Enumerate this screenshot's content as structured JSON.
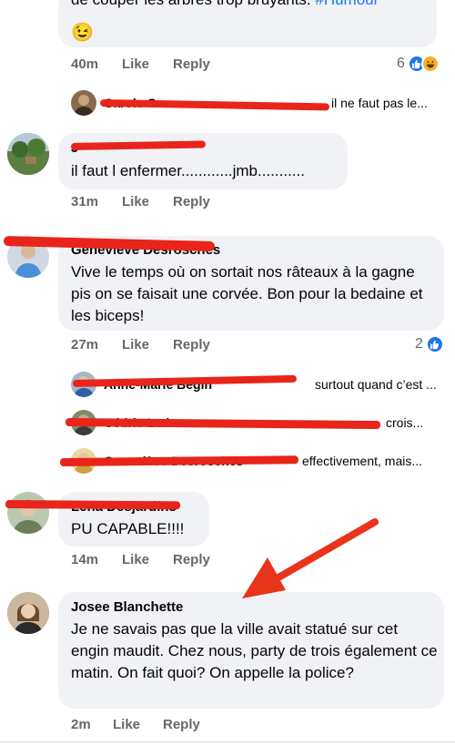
{
  "comments": [
    {
      "text": "de couper les arbres trop bruyants. #Humour",
      "time": "40m",
      "like": "Like",
      "reply": "Reply",
      "reaction_count": "6",
      "reactions": [
        "like-icon",
        "haha-icon"
      ],
      "replies": [
        {
          "name": "Carole Caron",
          "preview": "il ne faut pas le..."
        }
      ]
    },
    {
      "name": "J",
      "text": "il faut l enfermer............jmb...........",
      "time": "31m",
      "like": "Like",
      "reply": "Reply"
    },
    {
      "name": "Geneviève Desrosches",
      "text": "Vive le temps où on sortait nos râteaux à la gagne pis on se faisait une corvée. Bon pour la bedaine et les biceps!",
      "time": "27m",
      "like": "Like",
      "reply": "Reply",
      "reaction_count": "2",
      "reactions": [
        "like-icon"
      ],
      "replies": [
        {
          "name": "Anne-Marie Bégin",
          "preview": "surtout quand c’est ..."
        },
        {
          "name": "Cédric Ledoux",
          "preview": "crois..."
        },
        {
          "name": "Geneviève Desrosches",
          "preview": "effectivement, mais..."
        }
      ]
    },
    {
      "name": "Lena Desjardins",
      "text": "PU CAPABLE!!!!",
      "time": "14m",
      "like": "Like",
      "reply": "Reply"
    },
    {
      "name": "Josee Blanchette",
      "text": "Je ne savais pas que la ville avait statué sur cet engin maudit. Chez nous, party de trois également ce matin. On fait quoi? On appelle la police?",
      "time": "2m",
      "like": "Like",
      "reply": "Reply"
    }
  ],
  "emoji": "😉",
  "colors": {
    "bubble": "#f0f2f5",
    "meta": "#65676b",
    "redaction": "#e8241b",
    "arrow": "#e8341b",
    "like_blue": "#1877f2",
    "hashtag": "#1877f2"
  }
}
